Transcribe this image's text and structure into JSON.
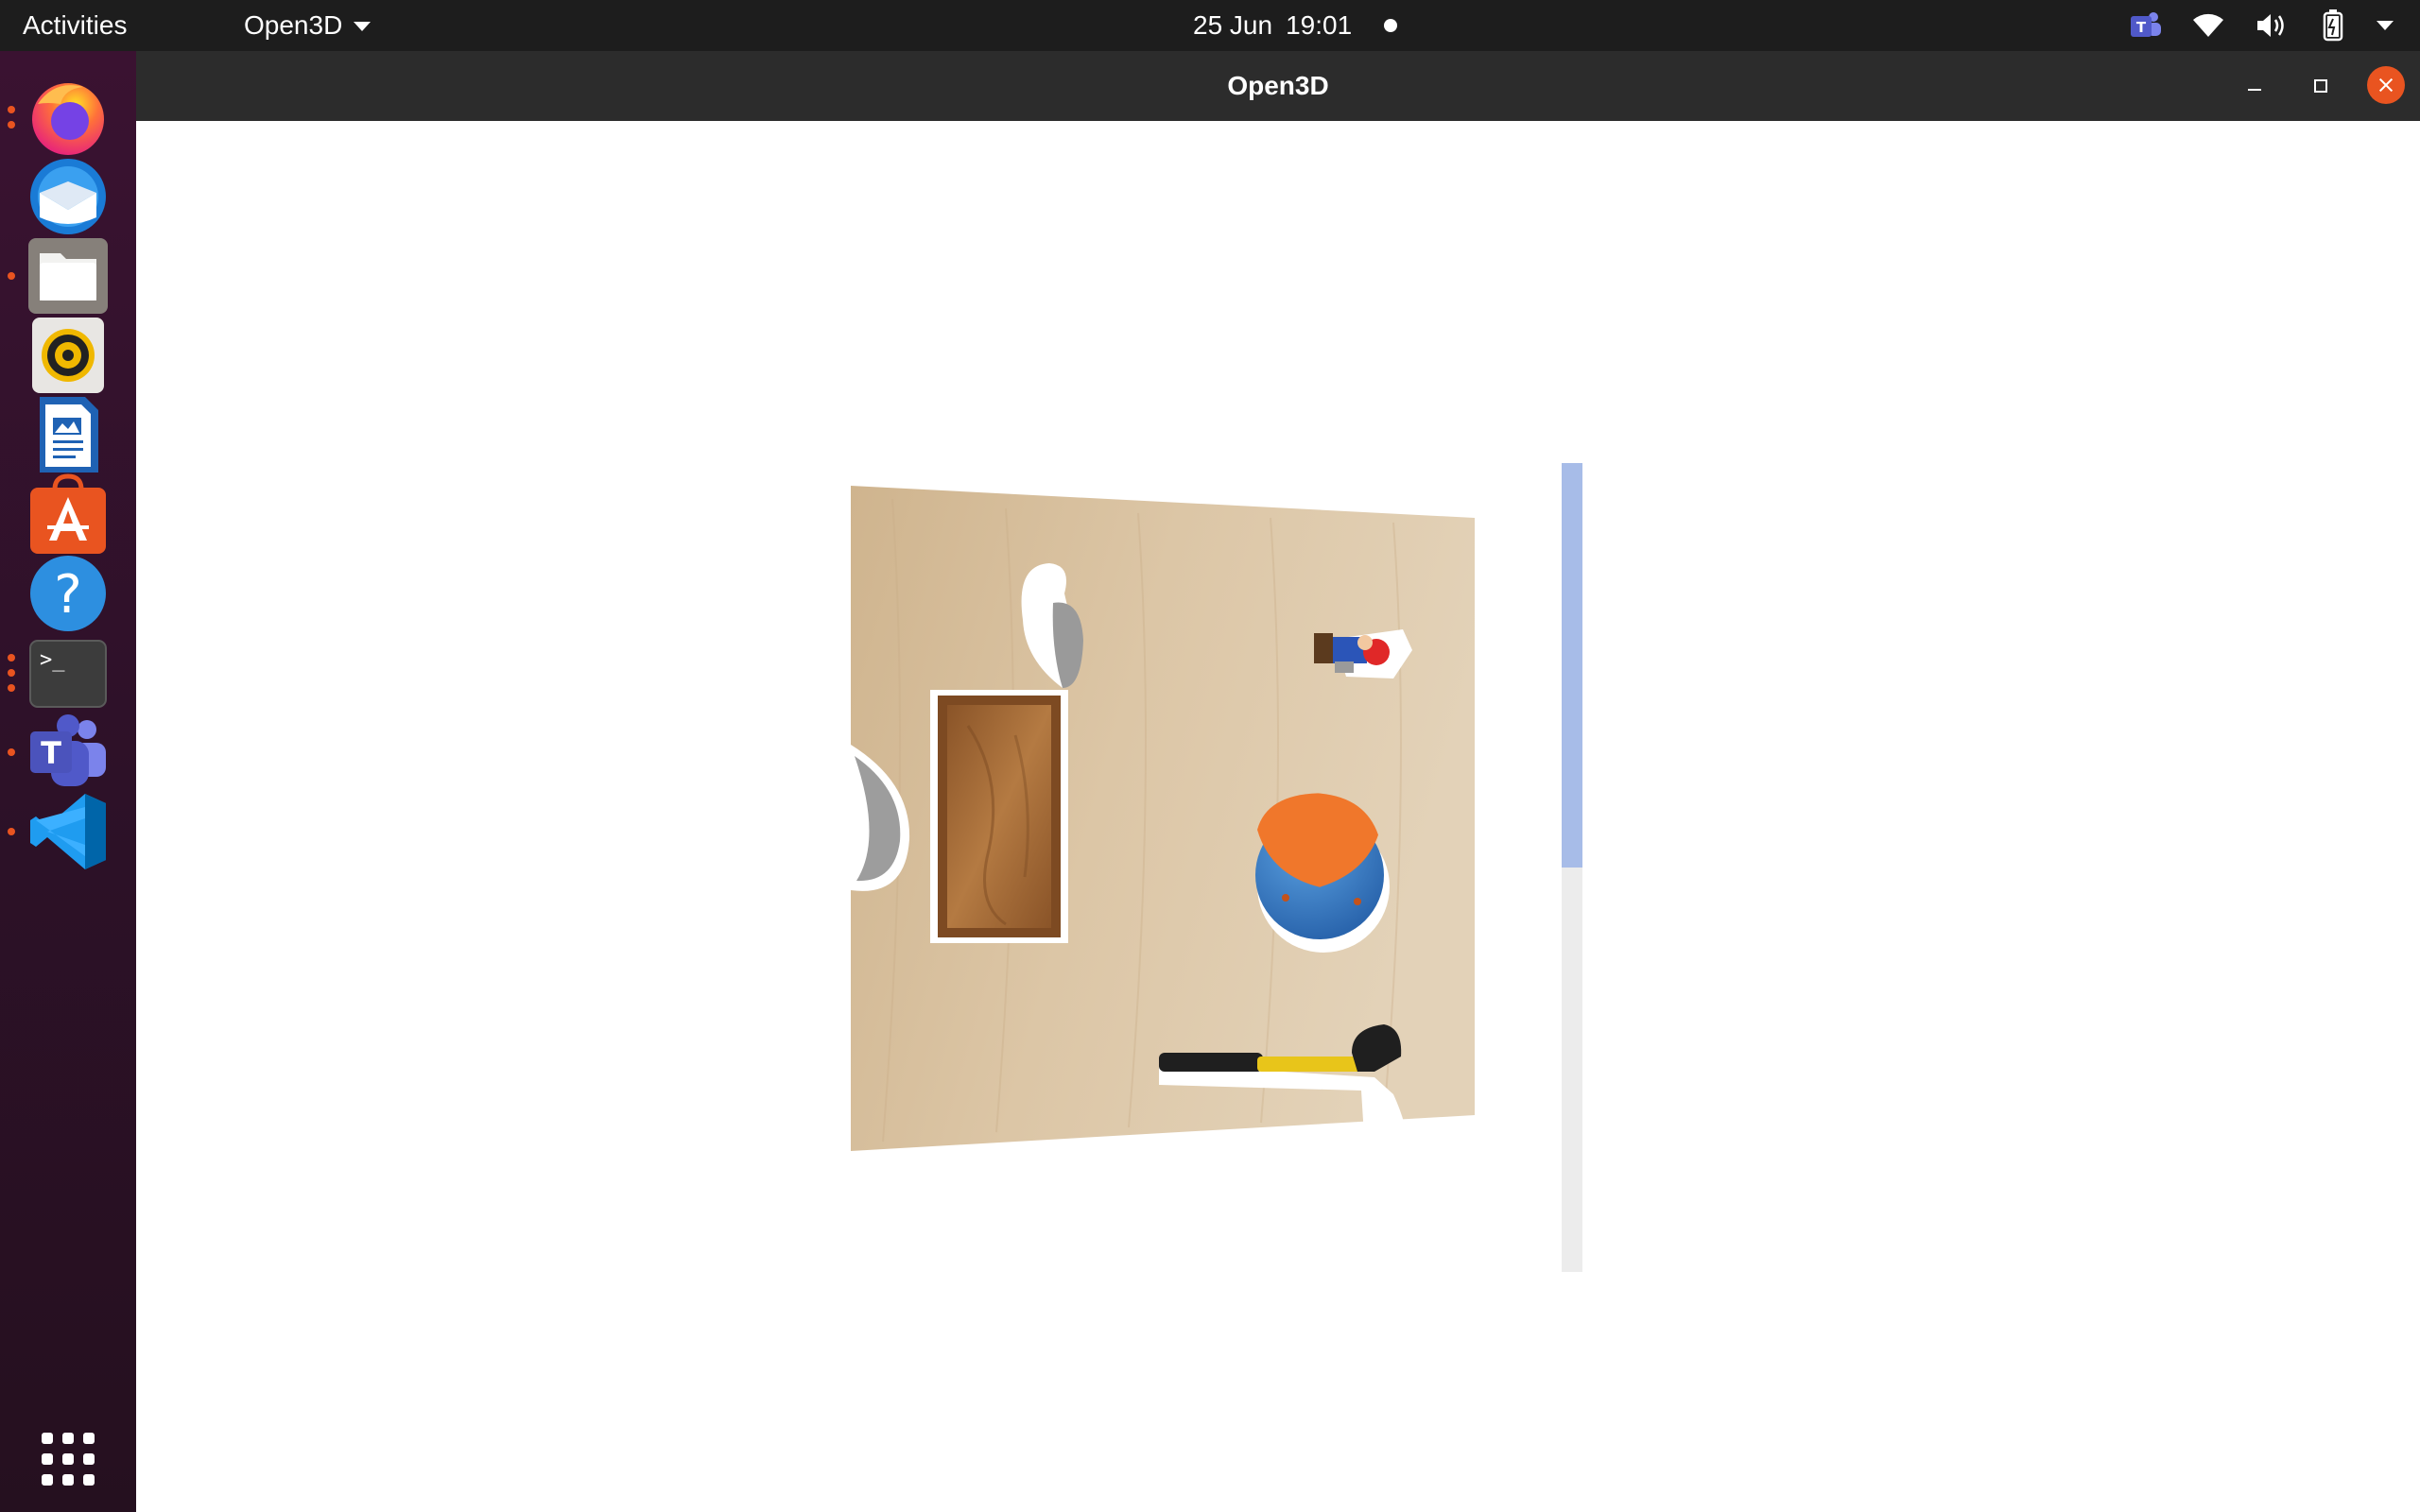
{
  "topbar": {
    "activities": "Activities",
    "app_menu": "Open3D",
    "date": "25 Jun",
    "time": "19:01",
    "tray_icons": [
      "teams-tray-icon",
      "wifi-icon",
      "volume-icon",
      "battery-icon",
      "system-menu-caret-icon"
    ]
  },
  "dock": {
    "items": [
      {
        "name": "firefox",
        "running": true
      },
      {
        "name": "thunderbird",
        "running": false
      },
      {
        "name": "files",
        "running": true
      },
      {
        "name": "rhythmbox",
        "running": false
      },
      {
        "name": "libreoffice-writer",
        "running": false
      },
      {
        "name": "ubuntu-software",
        "running": false
      },
      {
        "name": "help",
        "running": false
      },
      {
        "name": "terminal",
        "running": true
      },
      {
        "name": "microsoft-teams",
        "running": true
      },
      {
        "name": "visual-studio-code",
        "running": true
      },
      {
        "name": "show-applications",
        "running": false
      }
    ],
    "terminal_glyph": ">_"
  },
  "window": {
    "title": "Open3D"
  },
  "scene": {
    "description_objects": [
      "wooden-table-surface",
      "wooden-box",
      "blue-orange-ball",
      "hammer",
      "mario-figure",
      "gray-object",
      "bowl-shape"
    ],
    "colors": {
      "table": "#d9c3a3",
      "box": "#9b6634",
      "ball_blue": "#3a7fc8",
      "ball_orange": "#f0772b",
      "hammer_handle": "#e8c51a",
      "hammer_head": "#1f1f1f",
      "shadow": "#ffffff",
      "accent": "#e95420",
      "scroll_thumb": "#a7bce8"
    }
  },
  "scrollbar": {
    "position_fraction": 0.0,
    "visible_fraction": 0.5
  }
}
